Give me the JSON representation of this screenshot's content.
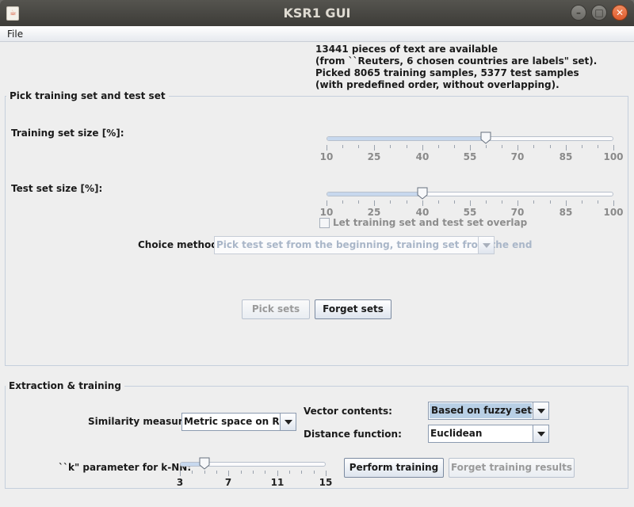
{
  "window": {
    "title": "KSR1 GUI",
    "app_icon": "java-icon"
  },
  "menu": {
    "file_label": "File"
  },
  "info_lines": [
    "13441 pieces of text are available",
    "(from ``Reuters, 6 chosen countries are labels\" set).",
    "Picked 8065 training samples, 5377 test samples",
    "(with predefined order, without overlapping)."
  ],
  "pick_sets": {
    "title": "Pick training set and test set",
    "training_label": "Training set size [%]:",
    "training_value": 60,
    "test_label": "Test set size [%]:",
    "test_value": 40,
    "slider_ticks": [
      "10",
      "25",
      "40",
      "55",
      "70",
      "85",
      "100"
    ],
    "overlap_label": "Let training set and test set overlap",
    "overlap_checked": false,
    "choice_label": "Choice method:",
    "choice_value": "Pick test set from the beginning, training set from the end",
    "pick_button": "Pick sets",
    "forget_button": "Forget sets"
  },
  "extraction": {
    "title": "Extraction & training",
    "similarity_label": "Similarity measure:",
    "similarity_value": "Metric space on R^n",
    "vector_label": "Vector contents:",
    "vector_value": "Based on fuzzy sets",
    "distance_label": "Distance function:",
    "distance_value": "Euclidean",
    "k_label": "``k\" parameter for k-NN:",
    "k_value": 5,
    "k_ticks": [
      "3",
      "7",
      "11",
      "15"
    ],
    "perform_button": "Perform training",
    "forget_button": "Forget training results"
  },
  "colors": {
    "accent": "#b8cfe5",
    "disabled_text": "#8d8d8d"
  }
}
